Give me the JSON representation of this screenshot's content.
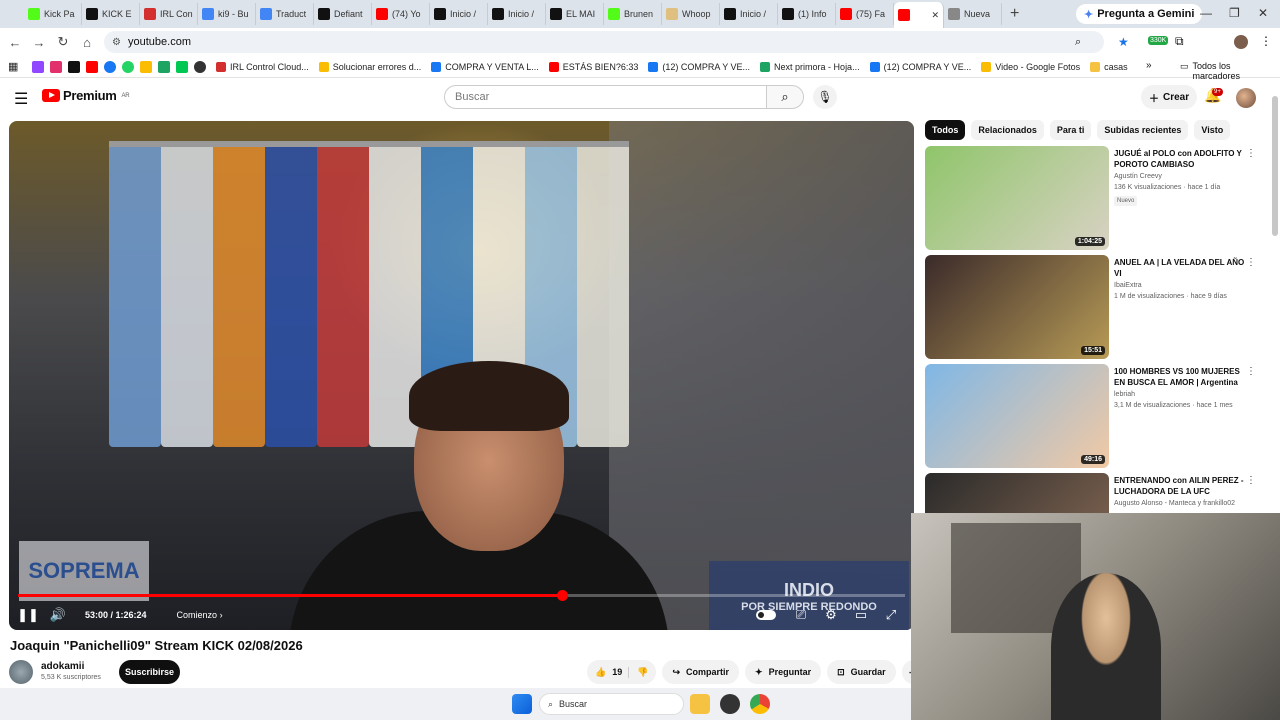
{
  "browser": {
    "tabs": [
      {
        "label": "Kick Pa",
        "color": "#53fc18"
      },
      {
        "label": "KICK E",
        "color": "#111111"
      },
      {
        "label": "IRL Con",
        "color": "#d32f2f"
      },
      {
        "label": "ki9 - Bu",
        "color": "#4285f4"
      },
      {
        "label": "Traduct",
        "color": "#4285f4"
      },
      {
        "label": "Defiant",
        "color": "#111111"
      },
      {
        "label": "(74) Yo",
        "color": "#ff0000"
      },
      {
        "label": "Inicio /",
        "color": "#111111"
      },
      {
        "label": "Inicio /",
        "color": "#111111"
      },
      {
        "label": "EL MAI",
        "color": "#111111"
      },
      {
        "label": "Brunen",
        "color": "#53fc18"
      },
      {
        "label": "Whoop",
        "color": "#e0c080"
      },
      {
        "label": "Inicio /",
        "color": "#111111"
      },
      {
        "label": "(1) Info",
        "color": "#111111"
      },
      {
        "label": "(75) Fa",
        "color": "#ff0000"
      },
      {
        "label": "",
        "color": "#ff0000",
        "active": true
      },
      {
        "label": "Nueva",
        "color": "#888888"
      }
    ],
    "gemini_label": "Pregunta a Gemini",
    "url": "youtube.com",
    "bookmarks": [
      "IRL Control Cloud...",
      "Solucionar errores d...",
      "COMPRA Y VENTA L...",
      "ESTÁS BIEN?6:33",
      "(12) COMPRA Y VE...",
      "Next primora - Hoja...",
      "(12) COMPRA Y VE...",
      "Video - Google Fotos",
      "casas"
    ],
    "all_bookmarks_label": "Todos los marcadores",
    "extension_badge": "330K"
  },
  "youtube": {
    "logo_text": "Premium",
    "logo_region": "AR",
    "search_placeholder": "Buscar",
    "create_label": "Crear",
    "notif_count": "9+",
    "player": {
      "current_time": "53:00",
      "duration": "1:26:24",
      "time_display": "53:00 / 1:26:24",
      "progress_fraction": 0.6134,
      "chapter_label": "Comienzo",
      "left_sign_text": "SOPREMA",
      "banner_text": "POR SIEMPRE REDONDO",
      "banner_top_text": "INDIO"
    },
    "video_title": "Joaquin \"Panichelli09\" Stream KICK 02/08/2026",
    "channel": {
      "name": "adokamii",
      "subscribers": "5,53 K suscriptores",
      "subscribe_label": "Suscribirse"
    },
    "actions": {
      "likes": "19",
      "share_label": "Compartir",
      "ask_label": "Preguntar",
      "save_label": "Guardar"
    },
    "chips": [
      "Todos",
      "Relacionados",
      "Para ti",
      "Subidas recientes",
      "Visto"
    ],
    "recommendations": [
      {
        "title": "JUGUÉ al POLO con ADOLFITO Y POROTO CAMBIASO",
        "channel": "Agustín Creevy",
        "meta": "136 K visualizaciones · hace 1 día",
        "badge": "Nuevo",
        "duration": "1:04:25",
        "thumb_colors": [
          "#8fc56a",
          "#d9d2c4"
        ]
      },
      {
        "title": "ANUEL AA | LA VELADA DEL AÑO VI",
        "channel": "IbaiExtra",
        "meta": "1 M de visualizaciones · hace 9 días",
        "duration": "15:51",
        "thumb_colors": [
          "#3a2a2a",
          "#b89b56"
        ]
      },
      {
        "title": "100 HOMBRES VS 100 MUJERES EN BUSCA EL AMOR | Argentina",
        "channel": "lebriah",
        "meta": "3,1 M de visualizaciones · hace 1 mes",
        "duration": "49:16",
        "thumb_colors": [
          "#7fb7e6",
          "#f2c9a4"
        ]
      },
      {
        "title": "ENTRENANDO con AILIN PEREZ - LUCHADORA DE LA UFC",
        "channel": "Augusto Alonso - Manteca y frankillo02",
        "meta": "",
        "duration": "",
        "thumb_colors": [
          "#2a2a2a",
          "#8a6b55"
        ]
      }
    ]
  },
  "taskbar": {
    "search_label": "Buscar"
  }
}
